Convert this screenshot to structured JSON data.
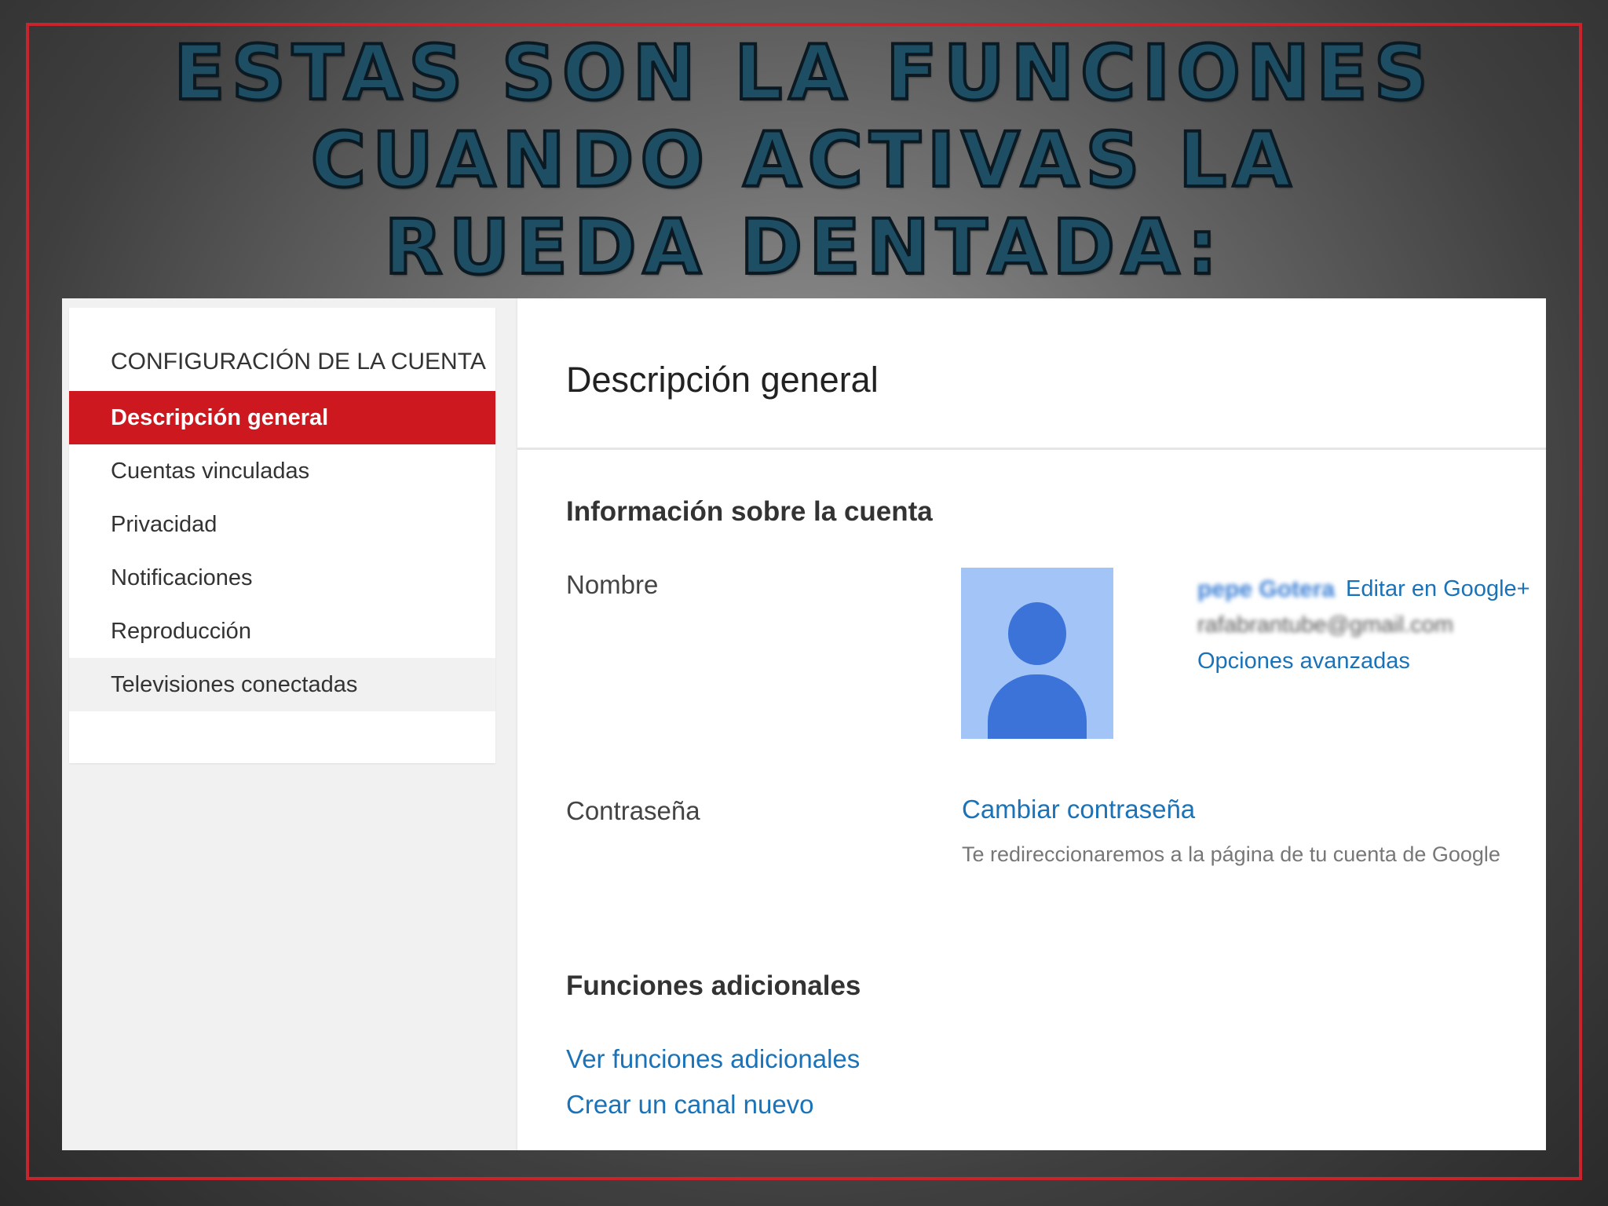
{
  "slide": {
    "title": "ESTAS SON LA FUNCIONES CUANDO ACTIVAS LA RUEDA DENTADA:",
    "colors": {
      "frame": "#c7242d",
      "title": "#1e4e63"
    }
  },
  "sidebar": {
    "heading": "CONFIGURACIÓN DE LA CUENTA",
    "items": [
      {
        "label": "Descripción general",
        "active": true
      },
      {
        "label": "Cuentas vinculadas"
      },
      {
        "label": "Privacidad"
      },
      {
        "label": "Notificaciones"
      },
      {
        "label": "Reproducción"
      },
      {
        "label": "Televisiones conectadas"
      }
    ],
    "active_color": "#cc181e"
  },
  "main": {
    "title": "Descripción general",
    "account_info": {
      "heading": "Información sobre la cuenta",
      "name_label": "Nombre",
      "user_name": "pepe Gotera",
      "edit_link": "Editar en Google+",
      "email": "rafabrantube@gmail.com",
      "advanced_link": "Opciones avanzadas",
      "avatar_icon": "default-user-avatar-icon"
    },
    "password": {
      "label": "Contraseña",
      "change_link": "Cambiar contraseña",
      "hint": "Te redireccionaremos a la página de tu cuenta de Google"
    },
    "additional": {
      "heading": "Funciones adicionales",
      "links": [
        "Ver funciones adicionales",
        "Crear un canal nuevo"
      ]
    },
    "link_color": "#1a73b8"
  }
}
